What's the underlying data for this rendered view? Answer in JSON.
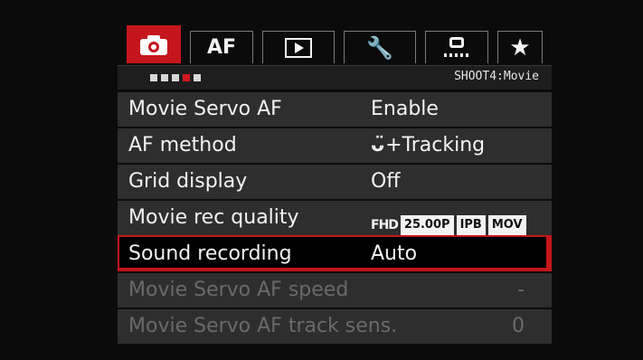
{
  "tabs": [
    {
      "id": "shoot",
      "label": "",
      "icon": "camera-icon",
      "active": true
    },
    {
      "id": "af",
      "label": "AF",
      "icon": "",
      "active": false
    },
    {
      "id": "playback",
      "label": "",
      "icon": "play-icon",
      "active": false
    },
    {
      "id": "setup",
      "label": "",
      "icon": "wrench-icon",
      "active": false
    },
    {
      "id": "custom",
      "label": "",
      "icon": "custom-functions-icon",
      "active": false
    },
    {
      "id": "mymenu",
      "label": "",
      "icon": "star-icon",
      "active": false
    }
  ],
  "subheader": {
    "page_label": "SHOOT4:Movie",
    "page_count": 5,
    "current_page": 4
  },
  "menu": {
    "items": [
      {
        "label": "Movie Servo AF",
        "value": "Enable"
      },
      {
        "label": "AF method",
        "value": "+Tracking",
        "value_icon": "face-tracking-icon"
      },
      {
        "label": "Grid display",
        "value": "Off"
      },
      {
        "label": "Movie rec quality",
        "value_parts": {
          "res": "FHD",
          "fps": "25.00P",
          "comp": "IPB",
          "format": "MOV"
        }
      },
      {
        "label": "Sound recording",
        "value": "Auto",
        "selected": true
      },
      {
        "label": "Movie Servo AF speed",
        "value": "-",
        "disabled": true
      },
      {
        "label": "Movie Servo AF track sens.",
        "value": "0",
        "disabled": true
      }
    ]
  },
  "colors": {
    "accent": "#c4161c",
    "background": "#0b0b0b",
    "row": "#2e2e2e",
    "disabled_text": "#6a6a6a"
  }
}
